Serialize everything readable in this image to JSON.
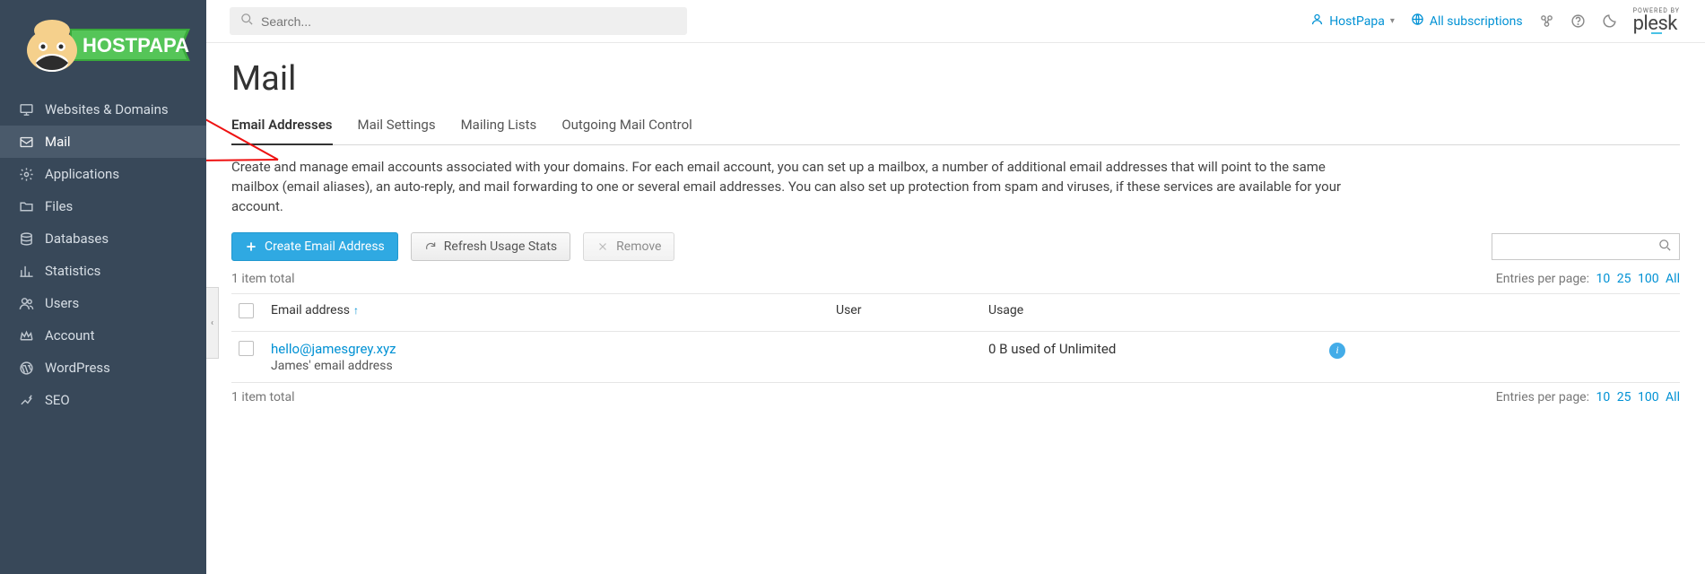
{
  "search": {
    "placeholder": "Search..."
  },
  "header": {
    "user": "HostPapa",
    "subscriptions": "All subscriptions",
    "powered": "POWERED BY",
    "brand": "plesk"
  },
  "sidebar": {
    "items": [
      {
        "label": "Websites & Domains"
      },
      {
        "label": "Mail"
      },
      {
        "label": "Applications"
      },
      {
        "label": "Files"
      },
      {
        "label": "Databases"
      },
      {
        "label": "Statistics"
      },
      {
        "label": "Users"
      },
      {
        "label": "Account"
      },
      {
        "label": "WordPress"
      },
      {
        "label": "SEO"
      }
    ]
  },
  "page": {
    "title": "Mail",
    "tabs": [
      {
        "label": "Email Addresses"
      },
      {
        "label": "Mail Settings"
      },
      {
        "label": "Mailing Lists"
      },
      {
        "label": "Outgoing Mail Control"
      }
    ],
    "description": "Create and manage email accounts associated with your domains. For each email account, you can set up a mailbox, a number of additional email addresses that will point to the same mailbox (email aliases), an auto-reply, and mail forwarding to one or several email addresses. You can also set up protection from spam and viruses, if these services are available for your account."
  },
  "actions": {
    "create": "Create Email Address",
    "refresh": "Refresh Usage Stats",
    "remove": "Remove"
  },
  "summary": {
    "total": "1 item total",
    "perpage_label": "Entries per page:",
    "per10": "10",
    "per25": "25",
    "per100": "100",
    "perAll": "All"
  },
  "table": {
    "col_email": "Email address",
    "col_user": "User",
    "col_usage": "Usage",
    "rows": [
      {
        "email": "hello@jamesgrey.xyz",
        "sub": "James' email address",
        "user": "",
        "usage": "0 B used of Unlimited"
      }
    ]
  }
}
